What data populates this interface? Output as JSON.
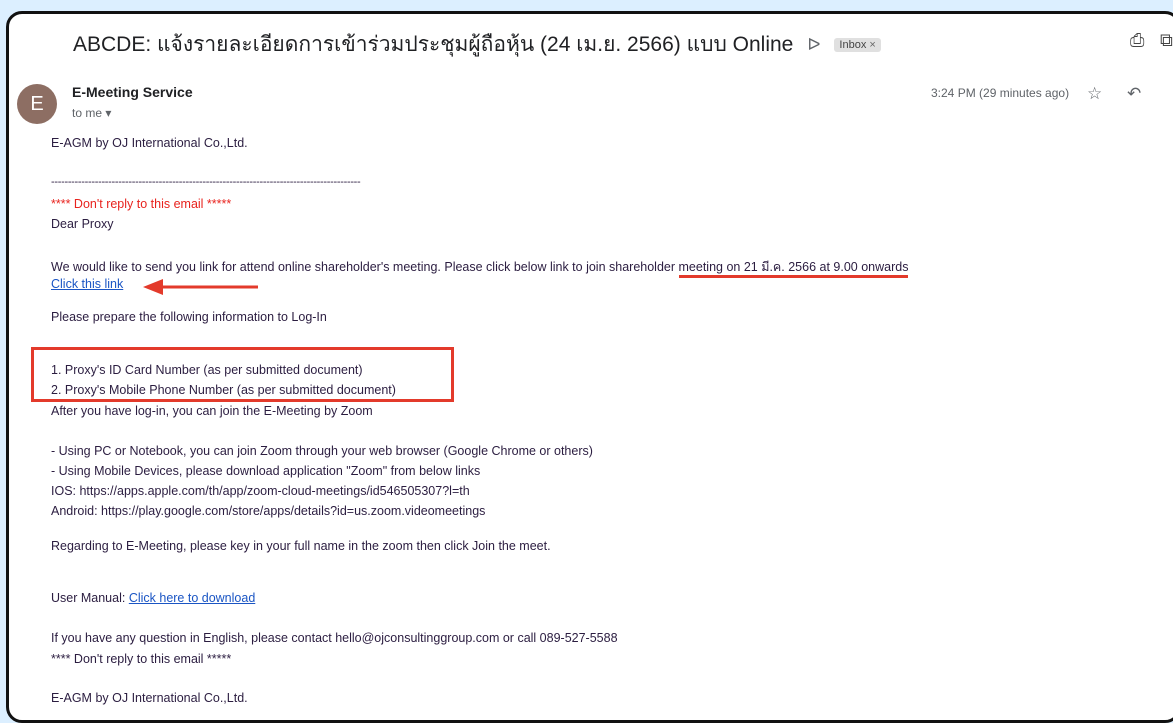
{
  "email": {
    "subject": "ABCDE: แจ้งรายละเอียดการเข้าร่วมประชุมผู้ถือหุ้น (24 เม.ย. 2566) แบบ Online",
    "label_chip": "Inbox",
    "label_chip_close": "×",
    "sender_initial": "E",
    "sender_name": "E-Meeting Service",
    "to_line": "to me",
    "to_caret": "▾",
    "time": "3:24 PM (29 minutes ago)"
  },
  "icons": {
    "important": "ᐅ",
    "print": "⎙",
    "new_window": "⧉",
    "star": "☆",
    "reply": "↶",
    "more": "⋮"
  },
  "body": {
    "company_top": "E-AGM by OJ International Co.,Ltd.",
    "dashes": "--------------------------------------------------------------------------------------------",
    "dont_reply_red": "**** Don't reply to this email *****",
    "greeting": "Dear Proxy",
    "intro_part1": "We would like to send you link for attend online shareholder's meeting. Please click below link to join shareholder ",
    "intro_part2": "meeting on 21 มี.ค. 2566 at 9.00 onwards",
    "click_link": "Click this link",
    "prepare": "Please prepare the following information to Log-In",
    "item1": "1. Proxy's ID Card Number (as per submitted document)",
    "item2": "2. Proxy's Mobile Phone Number (as per submitted document)",
    "after_login": "After you have log-in, you can join the E-Meeting by Zoom",
    "pc_line": "- Using PC or Notebook, you can join Zoom through your web browser (Google Chrome or others)",
    "mobile_line": "- Using Mobile Devices, please download application \"Zoom\" from below links",
    "ios_line": "IOS: https://apps.apple.com/th/app/zoom-cloud-meetings/id546505307?l=th",
    "android_line": "Android: https://play.google.com/store/apps/details?id=us.zoom.videomeetings",
    "regarding": "Regarding to E-Meeting, please key in your full name in the zoom then click Join the meet.",
    "manual_label": "User Manual: ",
    "manual_link": "Click here to download",
    "contact": "If you have any question in English, please contact hello@ojconsultinggroup.com or call 089-527-5588",
    "dont_reply_bottom": "**** Don't reply to this email *****",
    "company_bottom": "E-AGM by OJ International Co.,Ltd."
  },
  "colors": {
    "background": "#dcefff",
    "annotation_red": "#e33a2b",
    "link_blue": "#1a55c4",
    "warning_red": "#e8231e"
  }
}
